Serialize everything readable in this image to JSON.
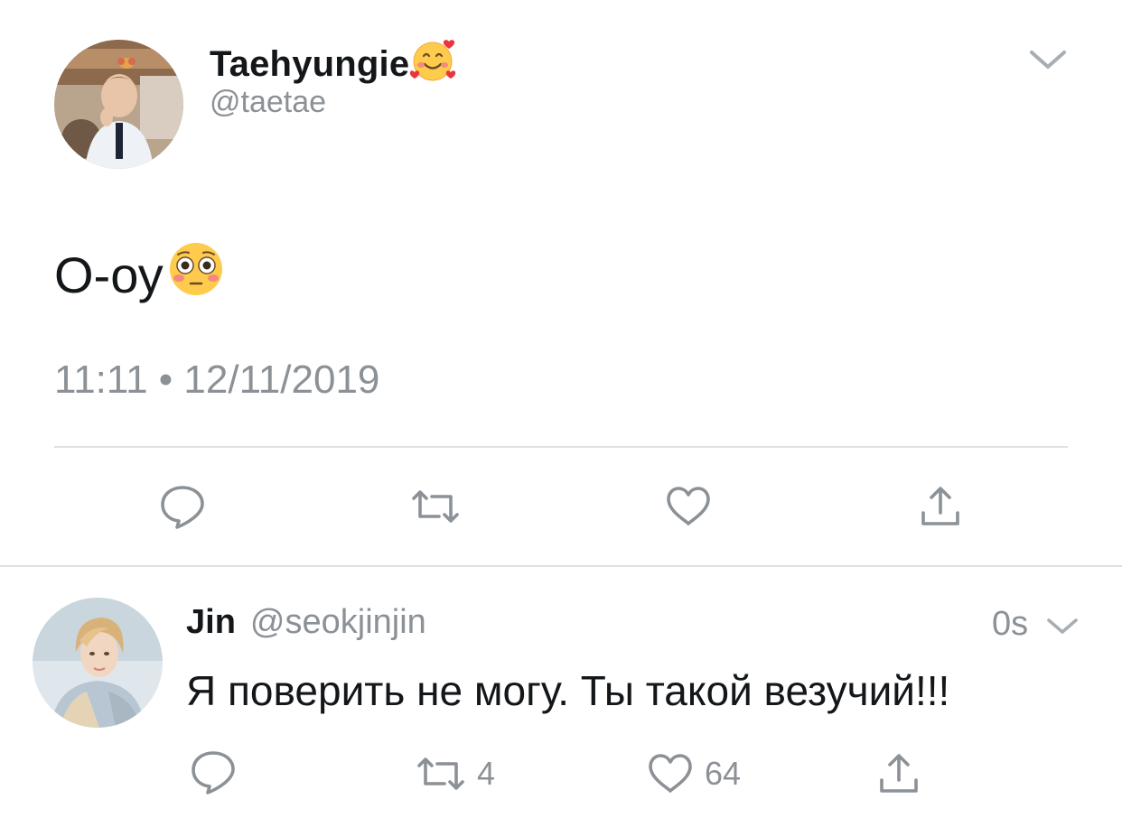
{
  "main_tweet": {
    "author_name": "Taehyungie",
    "author_emoji": "smiling-face-with-hearts-icon",
    "handle": "@taetae",
    "text": "О-оу",
    "text_emoji": "flushed-face-icon",
    "timestamp": "11:11 • 12/11/2019",
    "actions": {
      "reply": "reply-icon",
      "retweet": "retweet-icon",
      "like": "heart-icon",
      "share": "share-icon"
    }
  },
  "reply_tweet": {
    "author_name": "Jin",
    "handle": "@seokjinjin",
    "time": "0s",
    "text": "Я поверить не могу. Ты такой везучий!!!",
    "retweet_count": "4",
    "like_count": "64"
  },
  "colors": {
    "text_primary": "#14171a",
    "text_secondary": "#8b9196",
    "divider": "#dde1e4"
  }
}
